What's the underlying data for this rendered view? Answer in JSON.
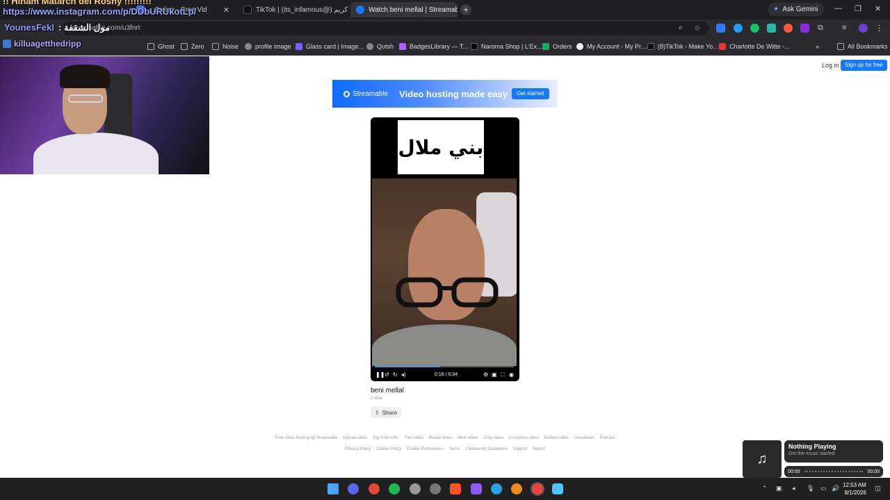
{
  "browser": {
    "tabs": [
      {
        "label": "...Online - Free Vid",
        "active": false
      },
      {
        "label": "TikTok | (its_infamous@) كريم",
        "active": false
      },
      {
        "label": "Watch beni mellal | Streamab",
        "active": true
      }
    ],
    "new_tab": "+",
    "ask_gemini": "Ask Gemini",
    "url": "streamable.com/u3fnrt",
    "bookmarks": [
      "Ghost",
      "Zero",
      "Noise",
      "profile image",
      "Glass card | Image...",
      "Qutsh",
      "BadgesLibrary — T...",
      "Naroma Shop | L'Ex...",
      "Orders",
      "My Account - My Pr...",
      "(8)TikTok - Make Yo...",
      "Charlotte De Witte -...",
      "All Bookmarks"
    ]
  },
  "overlay": {
    "title": "!! Hinam Matarch del Roshy !!!!!!!!!",
    "url": "https://www.instagram.com/p/DDbURUkotLp/",
    "user": "YounesFekl",
    "user_note": ": مول الشقفة",
    "chat": "killuagetthedripp"
  },
  "header": {
    "login": "Log in",
    "signup": "Sign up for free"
  },
  "banner": {
    "brand": "Streamable",
    "tagline": "Video hosting made easy",
    "cta": "Get started"
  },
  "video": {
    "overlay_text": "بني ملال",
    "time": "0:16 / 0:34",
    "progress": 0.47,
    "title": "beni mellal",
    "views": "1 view",
    "share": "Share"
  },
  "footer": {
    "row1": [
      "Free video hosting by Streamable",
      "Upload video",
      "Clip from URL",
      "Trim video",
      "Rotate video",
      "Mute video",
      "Crop video",
      "Compress video",
      "Embed video",
      "Livestream",
      "Podcast"
    ],
    "row2": [
      "Privacy Policy",
      "Cookie Policy",
      "Cookie Preferences",
      "Terms",
      "Community Guidelines",
      "Support",
      "Report"
    ]
  },
  "now_playing": {
    "title": "Nothing Playing",
    "subtitle": "Get the music started",
    "elapsed": "00:00",
    "total": "00:00"
  },
  "taskbar": {
    "time": "12:53 AM",
    "date": "8/1/2026"
  },
  "colors": {
    "accent": "#1479ff",
    "chrome_dark": "#1f1f23",
    "progress": "#4b8dff"
  }
}
